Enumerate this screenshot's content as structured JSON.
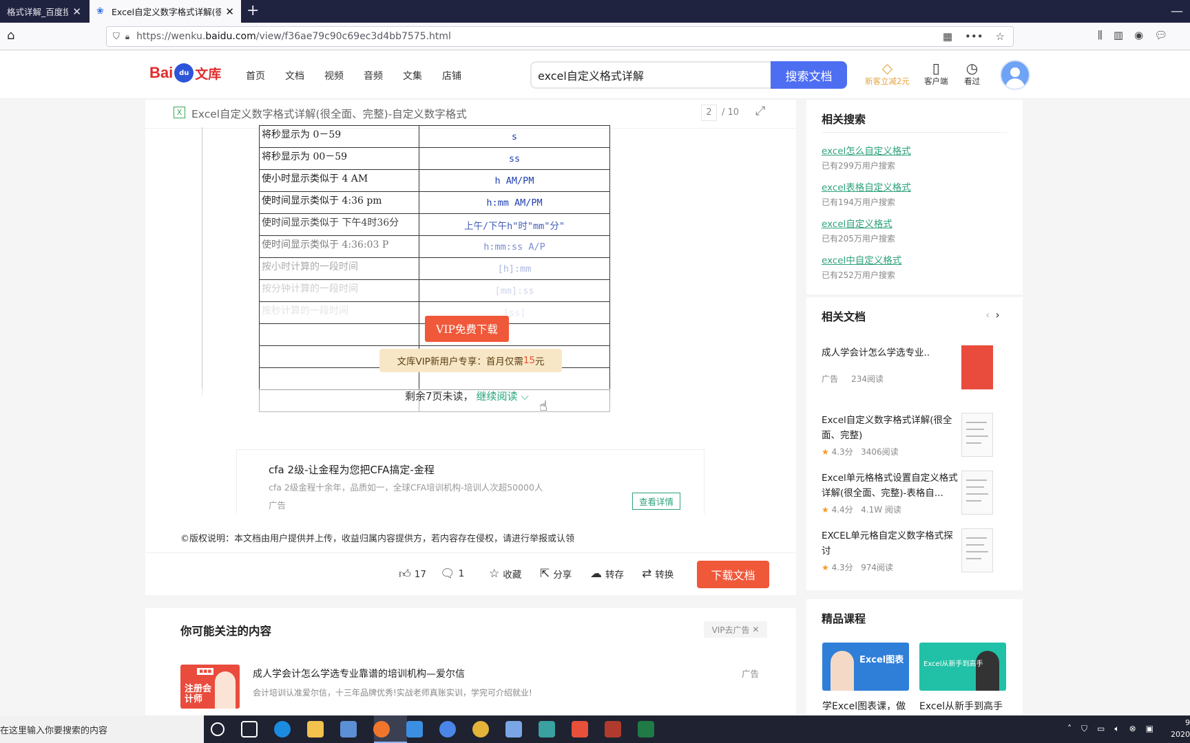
{
  "browser": {
    "tabs": [
      {
        "title": "格式详解_百度搜索",
        "active": false
      },
      {
        "title": "Excel自定义数字格式详解(很全",
        "active": true
      }
    ],
    "url_prefix": "https://wenku.",
    "url_host": "baidu.com",
    "url_path": "/view/f36ae79c90c69ec3d4bb7575.html"
  },
  "header": {
    "logo_bai": "Bai",
    "logo_du": "du",
    "logo_wenku": "文库",
    "nav": [
      "首页",
      "文档",
      "视频",
      "音频",
      "文集",
      "店铺"
    ],
    "search_value": "excel自定义格式详解",
    "search_button": "搜索文档",
    "vip_promo": "新客立减2元",
    "client": "客户端",
    "seen": "看过"
  },
  "document": {
    "title": "Excel自定义数字格式详解(很全面、完整)-自定义数字格式",
    "page_current": "2",
    "page_total": "/ 10",
    "table": [
      {
        "desc": "将秒显示为 0－59",
        "code": "s"
      },
      {
        "desc": "将秒显示为 00－59",
        "code": "ss"
      },
      {
        "desc": "使小时显示类似于 4 AM",
        "code": "h AM/PM"
      },
      {
        "desc": "使时间显示类似于 4:36 pm",
        "code": "h:mm AM/PM"
      },
      {
        "desc": "使时间显示类似于 下午4时36分",
        "code": "上午/下午h\"时\"mm\"分\""
      },
      {
        "desc": "使时间显示类似于 4:36:03 P",
        "code": "h:mm:ss A/P"
      },
      {
        "desc": "按小时计算的一段时间",
        "code": "[h]:mm"
      },
      {
        "desc": "按分钟计算的一段时间",
        "code": "[mm]:ss"
      },
      {
        "desc": "按秒计算的一段时间",
        "code": "[ss]"
      }
    ],
    "vip_download": "VIP免费下载",
    "vip_tip_prefix": "文库VIP新用户专享：首月仅需",
    "vip_tip_price": "15",
    "vip_tip_suffix": "元",
    "remaining": "剩余7页未读，",
    "continue_reading": "继续阅读"
  },
  "ad": {
    "title": "cfa 2级-让金程为您把CFA搞定-金程",
    "desc": "cfa 2级金程十余年，品质如一，全球CFA培训机构-培训人次超50000人",
    "tag": "广告",
    "detail_button": "查看详情"
  },
  "copyright": "©版权说明：本文档由用户提供并上传，收益归属内容提供方，若内容存在侵权，请进行举报或认领",
  "actions": {
    "likes": "17",
    "comments": "1",
    "favorite": "收藏",
    "share": "分享",
    "save": "转存",
    "convert": "转换",
    "download": "下载文档"
  },
  "recommend": {
    "title": "你可能关注的内容",
    "vip_remove_ad": "VIP去广告",
    "thumb_label": "注册会计师",
    "item_title": "成人学会计怎么学选专业靠谱的培训机构—爱尔信",
    "item_desc": "会计培训认准爱尔信，十三年品牌优秀!实战老师真账实训，学完可介绍就业!",
    "item_tag": "广告"
  },
  "sidebar": {
    "related_search_title": "相关搜索",
    "related_searches": [
      {
        "text": "excel怎么自定义格式",
        "count": "已有299万用户搜索"
      },
      {
        "text": "excel表格自定义格式",
        "count": "已有194万用户搜索"
      },
      {
        "text": "excel自定义格式",
        "count": "已有205万用户搜索"
      },
      {
        "text": "excel中自定义格式",
        "count": "已有252万用户搜索"
      }
    ],
    "related_docs_title": "相关文档",
    "related_docs": [
      {
        "title": "成人学会计怎么学选专业..",
        "meta1": "广告",
        "meta2": "234阅读",
        "rating": ""
      },
      {
        "title": "Excel自定义数字格式详解(很全面、完整)",
        "meta1": "4.3分",
        "meta2": "3406阅读",
        "rating": "★"
      },
      {
        "title": "Excel单元格格式设置自定义格式详解(很全面、完整)-表格自...",
        "meta1": "4.4分",
        "meta2": "4.1W 阅读",
        "rating": "★"
      },
      {
        "title": "EXCEL单元格自定义数字格式探讨",
        "meta1": "4.3分",
        "meta2": "974阅读",
        "rating": "★"
      }
    ],
    "courses_title": "精品课程",
    "courses": [
      {
        "label": "学Excel图表课，做",
        "thumb_text": "Excel图表"
      },
      {
        "label": "Excel从新手到高手",
        "thumb_text": "Excel从新手到高手"
      }
    ]
  },
  "taskbar": {
    "search_placeholder": "在这里输入你要搜索的内容",
    "clock_time": "9",
    "clock_date": "2020"
  }
}
